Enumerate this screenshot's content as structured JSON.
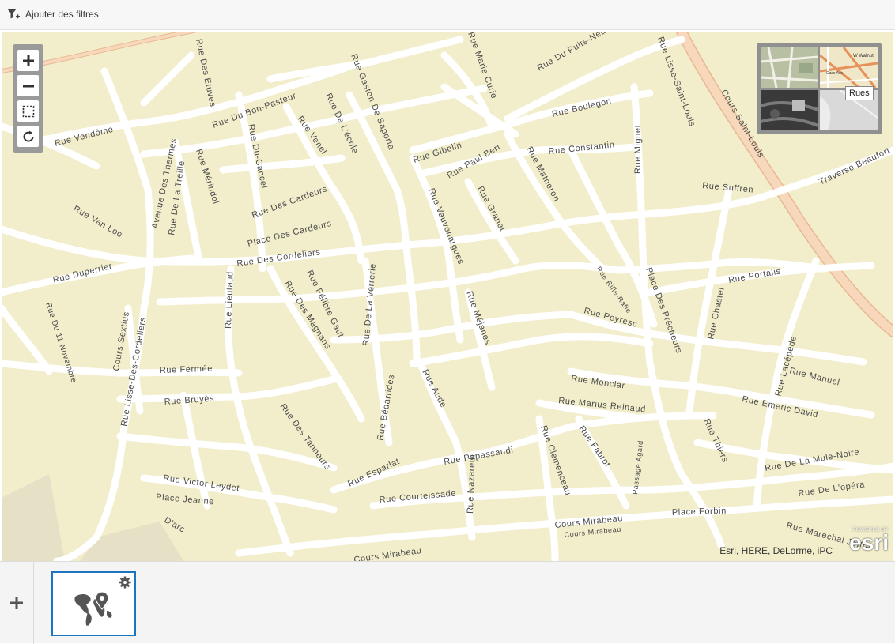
{
  "toolbar": {
    "add_filters_label": "Ajouter des filtres"
  },
  "map": {
    "attribution": "Esri, HERE, DeLorme, iPC",
    "esri_logo": {
      "powered_by": "POWERED BY",
      "name": "esri"
    },
    "basemap_tooltip": "Rues",
    "thumb_text": {
      "walnut": "W Walnut",
      "cass": "Cass Ave"
    },
    "zoom_controls": [
      "plus-icon",
      "minus-icon",
      "select-box-icon",
      "refresh-icon"
    ],
    "street_labels": {
      "l01": "Rue Des Etuves",
      "l02": "Rue Marie Curie",
      "l03": "Rue Du Puits-Neuf",
      "l04": "Rue Lisse-Saint-Louis",
      "l05": "Rue Gaston De Saporta",
      "l06": "Rue Du Bon-Pasteur",
      "l07": "Rue Vendôme",
      "l08": "Rue De L'école",
      "l09": "Rue Venel",
      "l10": "Rue Du-Cancel",
      "l11": "Rue Boulegon",
      "l12": "Rue Gibelin",
      "l13": "Rue Constantin",
      "l14": "Rue Mignet",
      "l15": "Cours Saint-Louis",
      "l16": "Avenue Des Thermes",
      "l17": "Rue De La Treille",
      "l18": "Rue Mérindol",
      "l19": "Rue Paul Bert",
      "l20": "Rue Matheron",
      "l21": "Traverse Beaufort",
      "l22": "Rue Suffren",
      "l23": "Rue Des Cardeurs",
      "l24": "Rue Van Loo",
      "l25": "Rue Granet",
      "l26": "Rue Vauvenargues",
      "l27": "Place Des Cardeurs",
      "l28": "Rue Duperrier",
      "l29": "Rue Des Cordeliers",
      "l30": "Rue Portalis",
      "l31": "Rue Du 11 Novembre",
      "l32": "Rue Lieutaud",
      "l33": "Rue Des Magnans",
      "l34": "Rue Félibre Gaut",
      "l35": "Rue De La Verrerie",
      "l36": "Rue Rifle-Rafle",
      "l37": "Place Des Prêcheurs",
      "l38": "Rue Chastel",
      "l39": "Cours Sextius",
      "l40": "Rue Lisse-Des-Cordeliers",
      "l41": "Rue Méjanes",
      "l42": "Rue Peyresc",
      "l43": "Rue Lacépède",
      "l44": "Rue Fermée",
      "l45": "Rue Bédarrides",
      "l46": "Rue Aude",
      "l47": "Rue Monclar",
      "l48": "Rue Manuel",
      "l49": "Rue Bruyès",
      "l50": "Rue Des Tanneurs",
      "l51": "Rue Marius Reinaud",
      "l52": "Rue Emeric David",
      "l53": "Rue Clemenceau",
      "l54": "Rue Fabrot",
      "l55": "Passage Agard",
      "l56": "Rue Thiers",
      "l57": "Rue Esparlat",
      "l58": "Rue Papassaudi",
      "l59": "Rue De La Mule-Noire",
      "l60": "Rue Victor Leydet",
      "l61": "Rue Courteissade",
      "l62": "Rue Nazareth",
      "l63": "Rue De L'opéra",
      "l64": "Place Jeanne",
      "l65": "D'arc",
      "l66": "Cours Mirabeau",
      "l67": "Cours Mirabeau",
      "l68": "Place Forbin",
      "l69": "Cours Mirabeau",
      "l70": "Rue Marechal Joffre"
    }
  },
  "widgets": {
    "add_icon": "plus-icon",
    "card_icon": "world-map-pin-icon",
    "card_settings_icon": "gear-icon"
  },
  "colors": {
    "land": "#f2eecb",
    "road": "#ffffff",
    "arterial": "#f7d2b1",
    "park": "#e5e0c6",
    "accent": "#1b76bf"
  }
}
